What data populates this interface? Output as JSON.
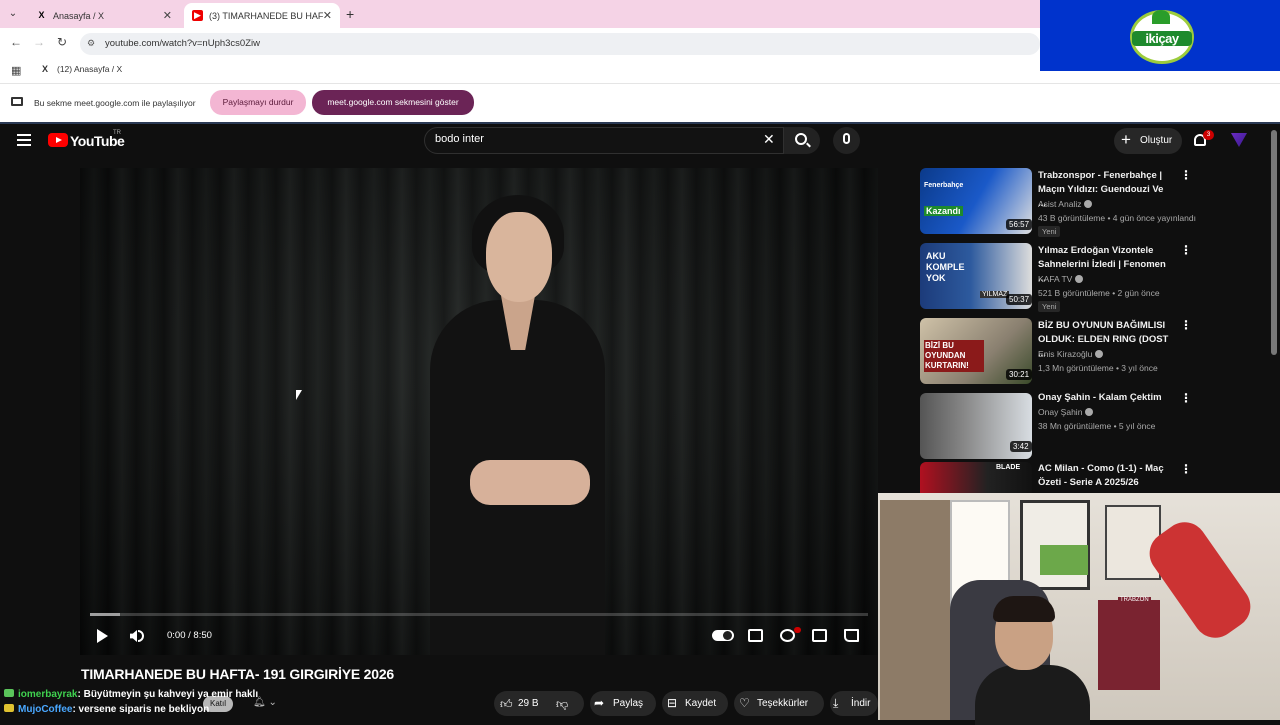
{
  "browser": {
    "tab_menu_icon": "chevron-down-icon",
    "tabs": [
      {
        "label": "Anasayfa / X",
        "icon": "x-logo-icon"
      },
      {
        "label": "(3) TIMARHANEDE BU HAF",
        "icon": "youtube-icon"
      }
    ],
    "close_glyph": "✕",
    "new_tab_glyph": "+",
    "url": "youtube.com/watch?v=nUph3cs0Ziw",
    "bookmark": {
      "label": "(12) Anasayfa / X"
    },
    "share_bar": {
      "text": "Bu sekme meet.google.com ile paylaşılıyor",
      "stop_label": "Paylaşmayı durdur",
      "show_label": "meet.google.com sekmesini göster"
    }
  },
  "overlay_logo": {
    "text": "ikiçay",
    "colors": {
      "box": "#0033cc",
      "green": "#1e8a2d"
    }
  },
  "youtube": {
    "wordmark": "YouTube",
    "region": "TR",
    "search": {
      "value": "bodo inter"
    },
    "create_label": "Oluştur",
    "notification_count": "3",
    "player": {
      "time": "0:00 / 8:50",
      "progress_fraction": 0.0
    },
    "video_title": "TIMARHANEDE BU HAFTA- 191 GIRGIRİYE 2026",
    "join_label": "Katıl",
    "actions": {
      "likes": "29 B",
      "share": "Paylaş",
      "save": "Kaydet",
      "thanks": "Teşekkürler",
      "download": "İndir"
    },
    "chat": [
      {
        "user": "iomerbayrak",
        "message": ": Büyütmeyin şu kahveyi ya emir haklı"
      },
      {
        "user": "MujoCoffee",
        "message": ": versene siparis ne bekliyon"
      }
    ],
    "recommendations": [
      {
        "title": "Trabzonspor - Fenerbahçe | Maçın Yıldızı: Guendouzi Ve ...",
        "channel": "Asist Analiz",
        "meta": "43 B görüntüleme • 4 gün önce yayınlandı",
        "badge": "Yeni",
        "duration": "56:57"
      },
      {
        "title": "Yılmaz Erdoğan Vizontele Sahnelerini İzledi | Fenomen ...",
        "channel": "KAFA TV",
        "meta": "521 B görüntüleme • 2 gün önce",
        "badge": "Yeni",
        "duration": "50:37"
      },
      {
        "title": "BİZ BU OYUNUN BAĞIMLISI OLDUK: ELDEN RING (DOST ...",
        "channel": "Enis Kirazoğlu",
        "meta": "1,3 Mn görüntüleme • 3 yıl önce",
        "badge": "",
        "duration": "30:21"
      },
      {
        "title": "Onay Şahin - Kalam Çektim",
        "channel": "Onay Şahin",
        "meta": "38 Mn görüntüleme • 5 yıl önce",
        "badge": "",
        "duration": "3:42"
      },
      {
        "title": "AC Milan - Como (1-1) - Maç Özeti - Serie A 2025/26",
        "channel": "",
        "meta": "",
        "badge": "",
        "duration": ""
      }
    ],
    "thumb_texts": [
      "Fenerbahçe",
      "Kazandı",
      "AKU KOMPLE YOK",
      "YILMAZ",
      "BİZİ BU OYUNDAN KURTARIN!",
      "BLADE"
    ]
  },
  "webcam": {
    "label": "TRABZON"
  }
}
